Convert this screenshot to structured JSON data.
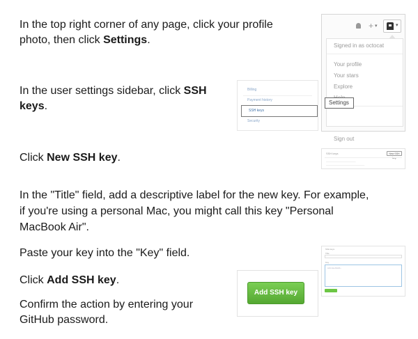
{
  "steps": {
    "s1": {
      "a": "In the top right corner of any page, click your profile",
      "b": "photo, then click ",
      "bold": "Settings",
      "c": "."
    },
    "s2": {
      "a": "In the user settings sidebar, click ",
      "bold1": "SSH",
      "bold2": "keys",
      "c": "."
    },
    "s3": {
      "a": "Click ",
      "bold": "New SSH key",
      "c": "."
    },
    "s4": {
      "l1": "In the \"Title\" field, add a descriptive label for the new key. For example,",
      "l2": "if you're using a personal Mac, you might call this key \"Personal",
      "l3": "MacBook Air\"."
    },
    "s5": "Paste your key into the \"Key\" field.",
    "s6": {
      "a": "Click ",
      "bold": "Add SSH key",
      "c": "."
    },
    "s7": {
      "l1": "Confirm the action by entering your",
      "l2": "GitHub password."
    }
  },
  "menu_shot": {
    "plus": "+",
    "signed_in": "Signed in as octocat",
    "items": [
      "Your profile",
      "Your stars",
      "Explore",
      "Help"
    ],
    "settings": "Settings",
    "sign_out": "Sign out"
  },
  "sidebar_shot": {
    "items": [
      "Billing",
      "Payment history",
      "SSH keys",
      "Security"
    ]
  },
  "newkey_shot": {
    "title": "SSH keys",
    "button": "New SSH key"
  },
  "form_shot": {
    "title": "SSH keys",
    "field_title": "Title",
    "field_key": "Key"
  },
  "add_button": {
    "label": "Add SSH key",
    "color": "#6cc644"
  }
}
